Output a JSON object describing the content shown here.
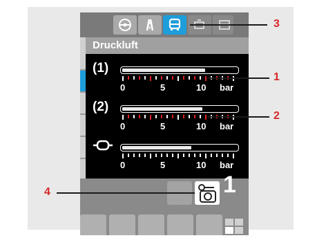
{
  "header": {
    "title": "Druckluft"
  },
  "tabs": [
    {
      "icon": "steering-wheel-icon",
      "active": false
    },
    {
      "icon": "road-icon",
      "active": false
    },
    {
      "icon": "bus-icon",
      "active": true
    },
    {
      "icon": "engine-icon",
      "active": false
    },
    {
      "icon": "gearbox-icon",
      "active": false
    }
  ],
  "gauges": [
    {
      "symbol": "(1)",
      "icon": "circuit-1-icon",
      "fill_fraction": 0.72,
      "scale": [
        "0",
        "5",
        "10",
        "bar"
      ]
    },
    {
      "symbol": "(2)",
      "icon": "circuit-2-icon",
      "fill_fraction": 0.7,
      "scale": [
        "0",
        "5",
        "10",
        "bar"
      ]
    },
    {
      "symbol": "",
      "icon": "brake-cylinder-icon",
      "fill_fraction": 0.6,
      "scale": [
        "0",
        "5",
        "10",
        "bar"
      ]
    }
  ],
  "status": {
    "icon": "fault-camera-icon",
    "count": "1"
  },
  "callouts": [
    "1",
    "2",
    "3",
    "4"
  ],
  "colors": {
    "accent": "#1e9ddb",
    "callout": "#d62828",
    "warning_tick": "#e02020"
  }
}
